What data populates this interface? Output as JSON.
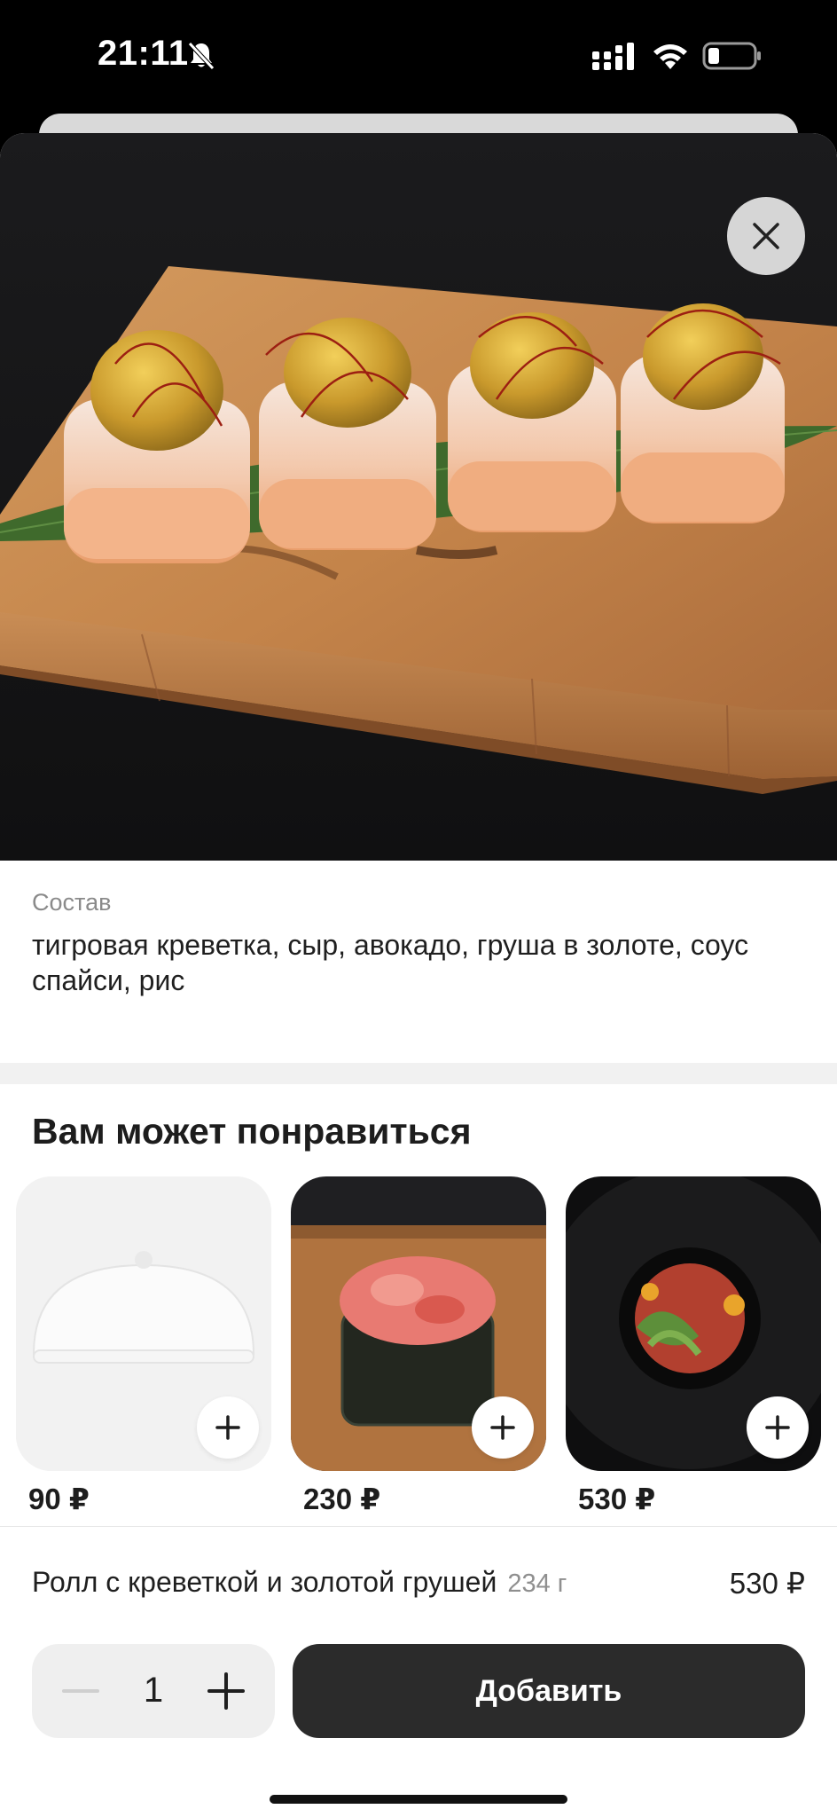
{
  "status": {
    "time": "21:11"
  },
  "composition": {
    "label": "Состав",
    "text": "тигровая креветка, сыр, авокадо, груша в золоте, соус спайси, рис"
  },
  "recommendations": {
    "title": "Вам может понравиться",
    "items": [
      {
        "price": "90 ₽",
        "image": "cloche-placeholder"
      },
      {
        "price": "230 ₽",
        "image": "tuna-gunkan"
      },
      {
        "price": "530 ₽",
        "image": "tuna-tartare-bowl"
      }
    ]
  },
  "product": {
    "name": "Ролл с креветкой и золотой грушей",
    "weight": "234 г",
    "price": "530 ₽",
    "quantity": "1",
    "add_label": "Добавить"
  },
  "colors": {
    "accent_dark": "#2b2b2b",
    "muted_text": "#8a8a8a"
  }
}
